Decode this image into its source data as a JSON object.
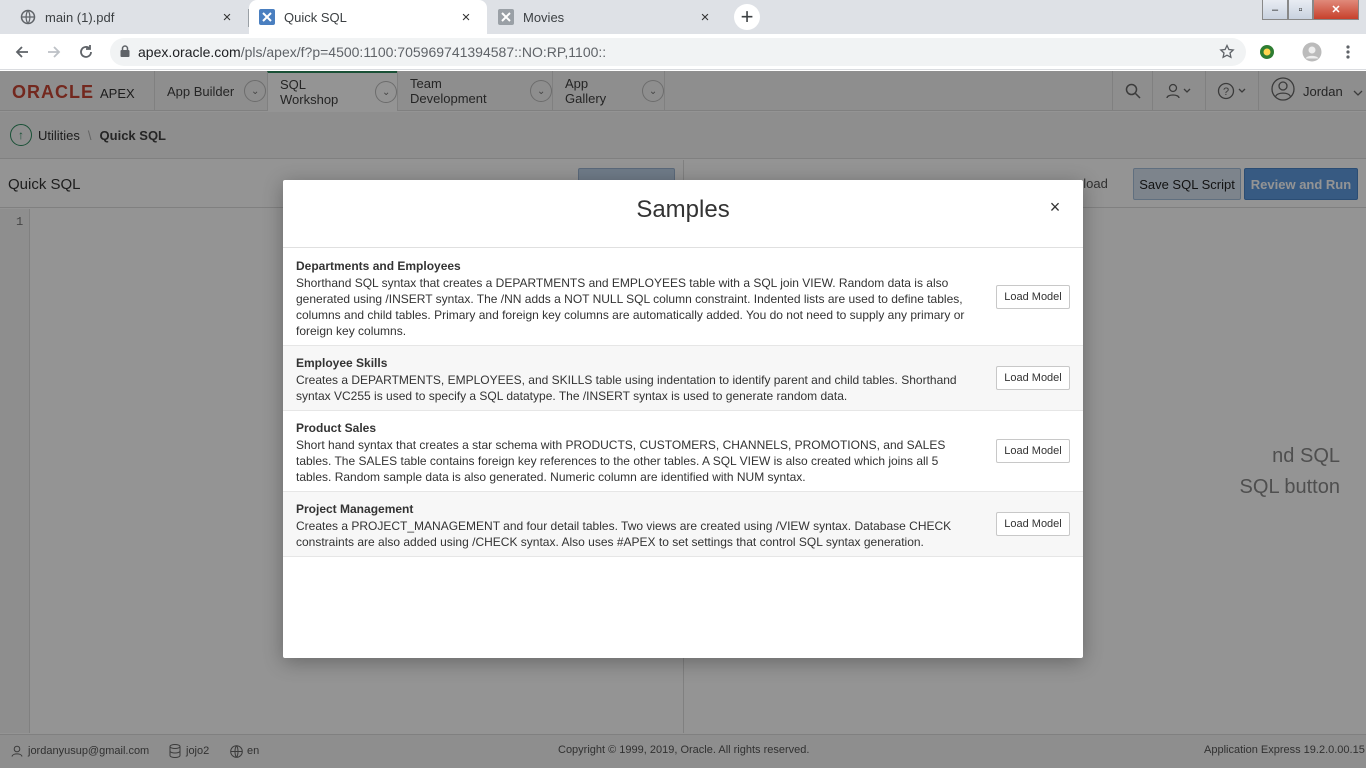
{
  "browser": {
    "tabs": [
      {
        "label": "main (1).pdf",
        "close": "×"
      },
      {
        "label": "Quick SQL",
        "close": "×"
      },
      {
        "label": "Movies",
        "close": "×"
      }
    ],
    "new_tab": "+",
    "window_controls": {
      "minimize": "–",
      "restore": "▫",
      "close": "✕"
    },
    "url_host": "apex.oracle.com",
    "url_path": "/pls/apex/f?p=4500:1100:705969741394587::NO:RP,1100::"
  },
  "apex": {
    "brand_oracle": "ORACLE",
    "brand_apex": "APEX",
    "nav": [
      {
        "label": "App Builder"
      },
      {
        "label": "SQL Workshop"
      },
      {
        "label": "Team Development"
      },
      {
        "label": "App Gallery"
      }
    ],
    "user": "Jordan",
    "breadcrumb": {
      "parent": "Utilities",
      "current": "Quick SQL"
    }
  },
  "page": {
    "title": "Quick SQL",
    "line_number": "1",
    "download_fragment": "nload",
    "save_script": "Save SQL Script",
    "review_run": "Review and Run",
    "hint_line1": "nd SQL",
    "hint_line2": "SQL button"
  },
  "modal": {
    "title": "Samples",
    "close": "×",
    "samples": [
      {
        "title": "Departments and Employees",
        "description": "Shorthand SQL syntax that creates a DEPARTMENTS and EMPLOYEES table with a SQL join VIEW. Random data is also generated using /INSERT syntax. The /NN adds a NOT NULL SQL column constraint. Indented lists are used to define tables, columns and child tables. Primary and foreign key columns are automatically added. You do not need to supply any primary or foreign key columns.",
        "button": "Load Model"
      },
      {
        "title": "Employee Skills",
        "description": "Creates a DEPARTMENTS, EMPLOYEES, and SKILLS table using indentation to identify parent and child tables. Shorthand syntax VC255 is used to specify a SQL datatype. The /INSERT syntax is used to generate random data.",
        "button": "Load Model"
      },
      {
        "title": "Product Sales",
        "description": "Short hand syntax that creates a star schema with PRODUCTS, CUSTOMERS, CHANNELS, PROMOTIONS, and SALES tables. The SALES table contains foreign key references to the other tables. A SQL VIEW is also created which joins all 5 tables. Random sample data is also generated. Numeric column are identified with NUM syntax.",
        "button": "Load Model"
      },
      {
        "title": "Project Management",
        "description": "Creates a PROJECT_MANAGEMENT and four detail tables. Two views are created using /VIEW syntax. Database CHECK constraints are also added using /CHECK syntax. Also uses #APEX to set settings that control SQL syntax generation.",
        "button": "Load Model"
      }
    ]
  },
  "footer": {
    "email": "jordanyusup@gmail.com",
    "workspace": "jojo2",
    "language": "en",
    "copyright": "Copyright © 1999, 2019, Oracle. All rights reserved.",
    "version": "Application Express 19.2.0.00.15"
  },
  "colors": {
    "oracle_red": "#c74634",
    "accent_green": "#2b8a5d",
    "primary_blue": "#5f9be0"
  }
}
